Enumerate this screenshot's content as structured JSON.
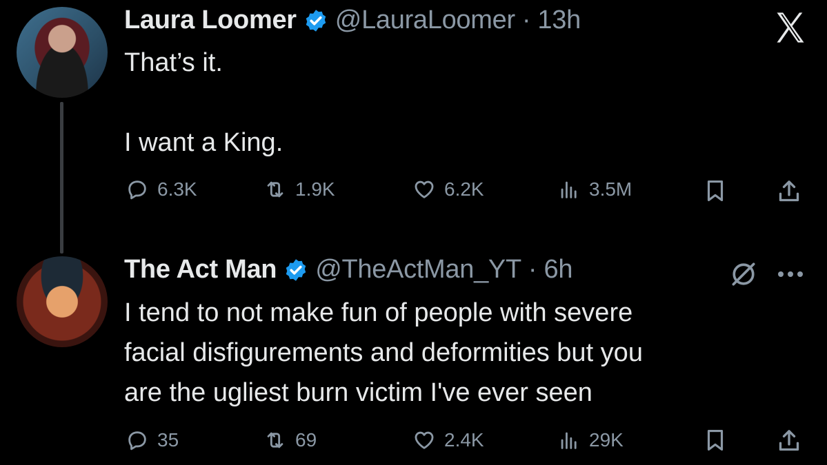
{
  "tweets": [
    {
      "name": "Laura Loomer",
      "handle": "@LauraLoomer",
      "time": "· 13h",
      "lines": [
        "That’s it.",
        "",
        "I want a King."
      ],
      "stats": {
        "replies": "6.3K",
        "reposts": "1.9K",
        "likes": "6.2K",
        "views": "3.5M"
      }
    },
    {
      "name": "The Act Man",
      "handle": "@TheActMan_YT",
      "time": "· 6h",
      "lines": [
        "I tend to not make fun of people with severe",
        "facial disfigurements and deformities but you",
        "are the ugliest burn victim I've ever seen"
      ],
      "stats": {
        "replies": "35",
        "reposts": "69",
        "likes": "2.4K",
        "views": "29K"
      }
    }
  ],
  "icons": {
    "brand": "x-logo-icon",
    "verified": "verified-badge-icon",
    "reply": "reply-icon",
    "repost": "repost-icon",
    "like": "heart-icon",
    "views": "views-icon",
    "bookmark": "bookmark-icon",
    "share": "share-icon",
    "grok": "grok-icon",
    "more": "more-icon"
  },
  "colors": {
    "background": "#000000",
    "text": "#e7e9ea",
    "muted": "#8b98a5",
    "verified": "#1d9bf0"
  }
}
